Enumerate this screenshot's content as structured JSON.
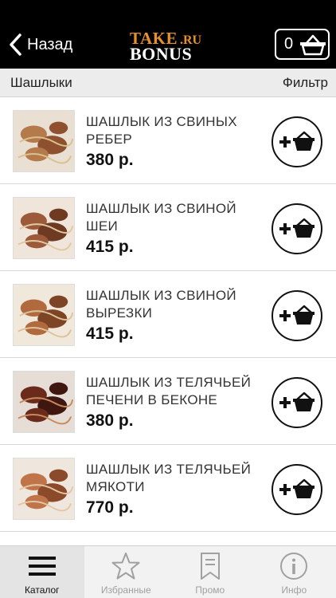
{
  "header": {
    "back_label": "Назад",
    "logo_take": "TAKE",
    "logo_ru": ".RU",
    "logo_bonus": "BONUS",
    "cart_count": "0"
  },
  "subheader": {
    "title": "Шашлыки",
    "filter_label": "Фильтр"
  },
  "items": [
    {
      "name": "ШАШЛЫК ИЗ СВИНЫХ РЕБЕР",
      "price": "380 р."
    },
    {
      "name": "ШАШЛЫК ИЗ СВИНОЙ ШЕИ",
      "price": "415 р."
    },
    {
      "name": "ШАШЛЫК ИЗ СВИНОЙ ВЫРЕЗКИ",
      "price": "415 р."
    },
    {
      "name": "ШАШЛЫК ИЗ ТЕЛЯЧЬЕЙ ПЕЧЕНИ В БЕКОНЕ",
      "price": "380 р."
    },
    {
      "name": "ШАШЛЫК ИЗ ТЕЛЯЧЬЕЙ МЯКОТИ",
      "price": "770 р."
    }
  ],
  "tabs": [
    {
      "label": "Каталог",
      "icon": "menu-icon",
      "active": true
    },
    {
      "label": "Избранные",
      "icon": "star-icon",
      "active": false
    },
    {
      "label": "Промо",
      "icon": "bookmark-icon",
      "active": false
    },
    {
      "label": "Инфо",
      "icon": "info-icon",
      "active": false
    }
  ],
  "colors": {
    "header_bg": "#000000",
    "logo_accent": "#e8912a",
    "tab_inactive": "#a0a0a0"
  }
}
